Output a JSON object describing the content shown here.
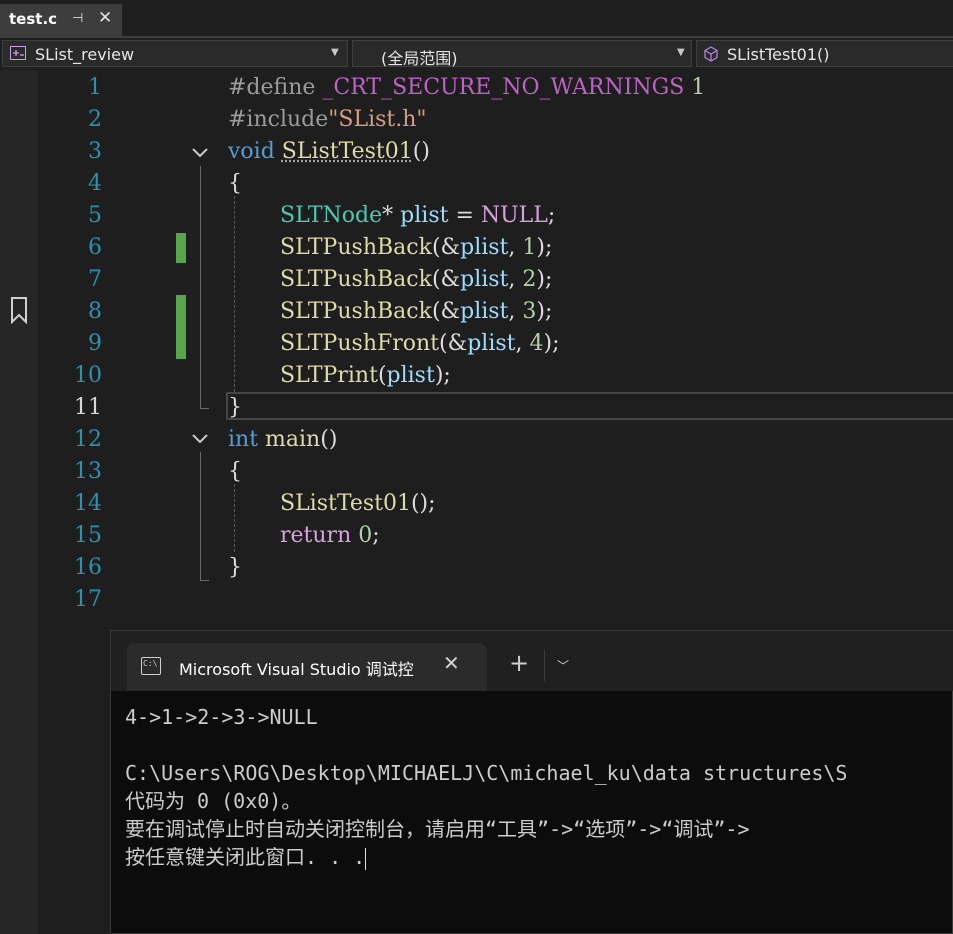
{
  "tab": {
    "filename": "test.c",
    "pin_icon": "pin-icon",
    "close_icon": "close-icon"
  },
  "navbar": {
    "project": "SList_review",
    "scope": "(全局范围)",
    "member": "SListTest01()"
  },
  "editor": {
    "line_numbers": [
      "1",
      "2",
      "3",
      "4",
      "5",
      "6",
      "7",
      "8",
      "9",
      "10",
      "11",
      "12",
      "13",
      "14",
      "15",
      "16",
      "17"
    ],
    "current_line": "11",
    "changed_lines": [
      "6",
      "8",
      "9"
    ],
    "code": {
      "l1": {
        "a": "#define ",
        "b": "_CRT_SECURE_NO_WARNINGS",
        "c": " 1"
      },
      "l2": {
        "a": "#include",
        "b": "\"SList.h\""
      },
      "l3": {
        "a": "void",
        "b": " ",
        "c": "SListTest01",
        "d": "()"
      },
      "l4": "{",
      "l5": {
        "a": "SLTNode",
        "b": "* ",
        "c": "plist",
        "d": " = ",
        "e": "NULL",
        "f": ";"
      },
      "l6": {
        "a": "SLTPushBack",
        "b": "(&",
        "c": "plist",
        "d": ", ",
        "e": "1",
        "f": ");"
      },
      "l7": {
        "a": "SLTPushBack",
        "b": "(&",
        "c": "plist",
        "d": ", ",
        "e": "2",
        "f": ");"
      },
      "l8": {
        "a": "SLTPushBack",
        "b": "(&",
        "c": "plist",
        "d": ", ",
        "e": "3",
        "f": ");"
      },
      "l9": {
        "a": "SLTPushFront",
        "b": "(&",
        "c": "plist",
        "d": ", ",
        "e": "4",
        "f": ");"
      },
      "l10": {
        "a": "SLTPrint",
        "b": "(",
        "c": "plist",
        "d": ");"
      },
      "l11": "}",
      "l12": {
        "a": "int",
        "b": " ",
        "c": "main",
        "d": "()"
      },
      "l13": "{",
      "l14": {
        "a": "SListTest01",
        "b": "();"
      },
      "l15": {
        "a": "return",
        "b": " ",
        "c": "0",
        "d": ";"
      },
      "l16": "}"
    }
  },
  "console": {
    "title": "Microsoft Visual Studio 调试控",
    "new_tab_label": "+",
    "output": [
      "4->1->2->3->NULL",
      "",
      "C:\\Users\\ROG\\Desktop\\MICHAELJ\\C\\michael_ku\\data structures\\S",
      "代码为 0 (0x0)。",
      "要在调试停止时自动关闭控制台，请启用“工具”->“选项”->“调试”->",
      "按任意键关闭此窗口. . ."
    ]
  },
  "colors": {
    "keyword": "#569cd6",
    "type": "#4ec9b0",
    "function": "#dcdcaa",
    "variable": "#9cdcfe",
    "number": "#b5cea8",
    "string": "#d69d85",
    "control_keyword": "#d8a0df",
    "macro": "#bd63c5",
    "line_number": "#2b91af",
    "change_marker": "#57a64a"
  }
}
